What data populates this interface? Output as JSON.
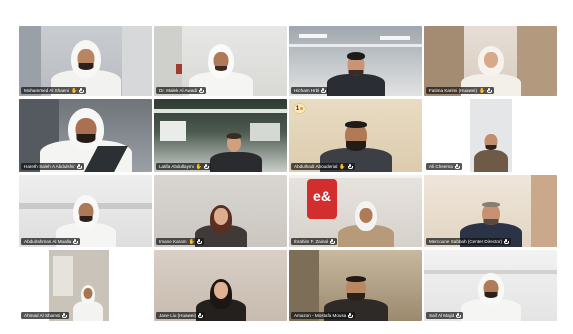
{
  "app": {
    "view": "gallery"
  },
  "active_speaker": "Abdulhadi Abouderial",
  "reaction": {
    "label": "1"
  },
  "participants": [
    {
      "name": "Mohammed Al Shaeni"
    },
    {
      "name": "Dr. Malek Al Awadi"
    },
    {
      "name": "Hicham Hrbl"
    },
    {
      "name": "Fatima Karimi (Huawei)"
    },
    {
      "name": "Hareth Saleh A Abdulshir"
    },
    {
      "name": "Latifa Abdullaymi"
    },
    {
      "name": "Abdulhadi Abouderial"
    },
    {
      "name": "Ali Cheema"
    },
    {
      "name": "Abdulrahman Al Mualla"
    },
    {
      "name": "Imane Karam"
    },
    {
      "name": "Ibrahim F. Zainal"
    },
    {
      "name": "Mercoune Sabbah (Center Director)"
    },
    {
      "name": "Ahmad Al Shamsi"
    },
    {
      "name": "Jane Liu (Huawei)"
    },
    {
      "name": "Amazon - Mostafa Mousa"
    },
    {
      "name": "Saif Al Majid"
    }
  ],
  "signage": {
    "logo_text": "e&"
  },
  "icons": {
    "mic": "mic-icon",
    "hand": "raise-hand-icon"
  },
  "colors": {
    "speaker_outline": "#e8b64a",
    "name_tag_bg": "#141414"
  }
}
